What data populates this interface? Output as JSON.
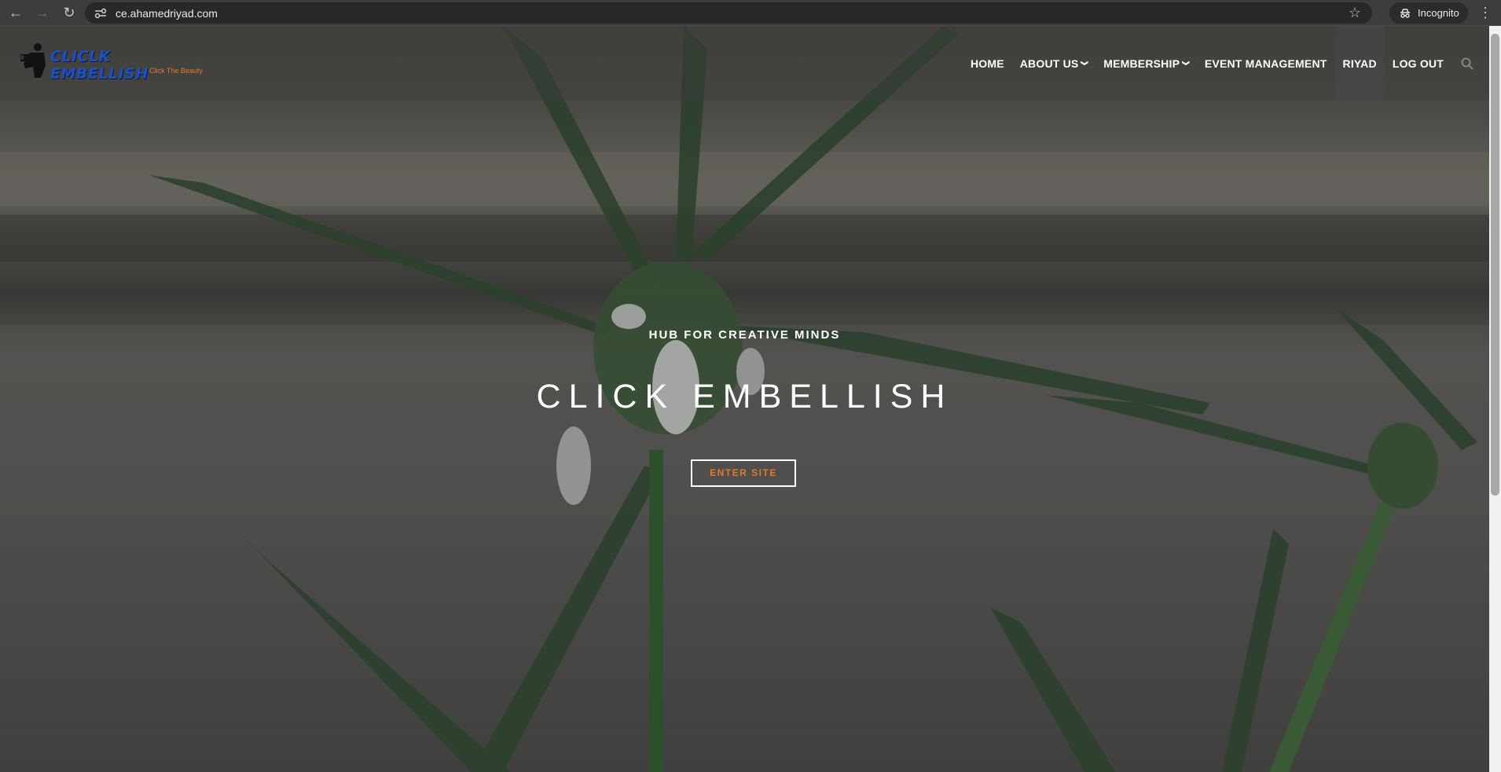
{
  "browser": {
    "url": "ce.ahamedriyad.com",
    "incognito_label": "Incognito"
  },
  "site": {
    "logo_title": "CLICLK EMBELLISH",
    "logo_tagline": "Click The Beauty",
    "nav": [
      {
        "label": "HOME",
        "has_dropdown": false
      },
      {
        "label": "ABOUT US",
        "has_dropdown": true
      },
      {
        "label": "MEMBERSHIP",
        "has_dropdown": true
      },
      {
        "label": "EVENT MANAGEMENT",
        "has_dropdown": false
      },
      {
        "label": "RIYAD",
        "has_dropdown": false,
        "active": true
      },
      {
        "label": "LOG OUT",
        "has_dropdown": false
      }
    ]
  },
  "hero": {
    "kicker": "HUB FOR CREATIVE MINDS",
    "title": "CLICK EMBELLISH",
    "button_label": "ENTER SITE"
  },
  "colors": {
    "accent": "#e47a25",
    "logo_blue": "#1f4fbf"
  }
}
